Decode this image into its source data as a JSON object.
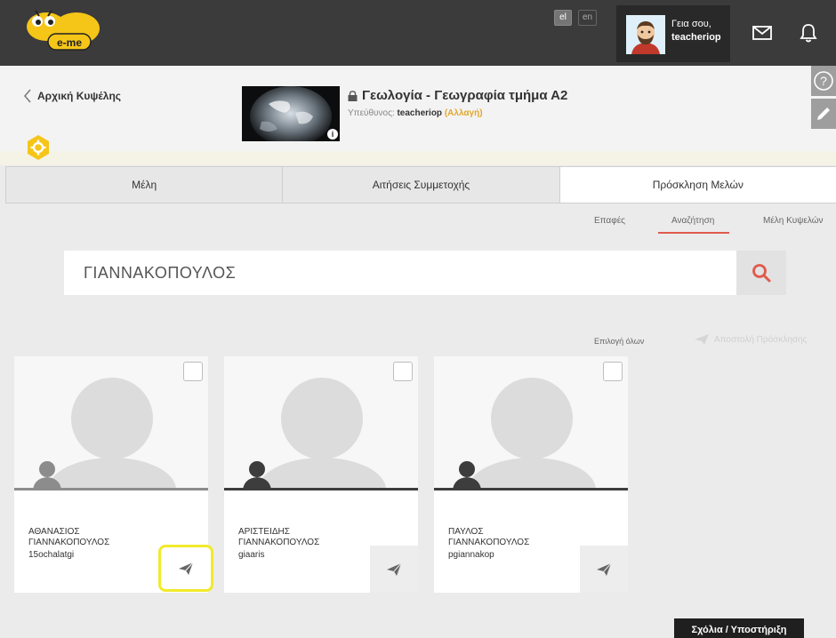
{
  "topbar": {
    "logo_text": "e-me",
    "languages": [
      "el",
      "en"
    ],
    "active_language": "el",
    "greeting_line1": "Γεια σου,",
    "greeting_line2": "teacheriop",
    "icons": [
      "mail-icon",
      "bell-icon"
    ]
  },
  "header": {
    "back_label": "Αρχική Κυψέλης",
    "hive_title": "Γεωλογία - Γεωγραφία τμήμα Α2",
    "owner_label": "Υπεύθυνος:",
    "owner_name": "teacheriop",
    "owner_change": "(Αλλαγή)",
    "info_badge": "i",
    "side_icons": [
      "help-icon",
      "edit-icon"
    ]
  },
  "tabs": [
    {
      "label": "Μέλη",
      "active": false
    },
    {
      "label": "Αιτήσεις Συμμετοχής",
      "active": false
    },
    {
      "label": "Πρόσκληση Μελών",
      "active": true
    }
  ],
  "subtabs": [
    {
      "label": "Επαφές",
      "active": false
    },
    {
      "label": "Αναζήτηση",
      "active": true
    },
    {
      "label": "Μέλη Κυψελών",
      "active": false
    }
  ],
  "search": {
    "value": "ΓΙΑΝΝΑΚΟΠΟΥΛΟΣ"
  },
  "actions": {
    "select_all": "Επιλογή όλων",
    "send_invite": "Αποστολή Πρόσκλησης"
  },
  "cards": [
    {
      "first_name": "ΑΘΑΝΑΣΙΟΣ",
      "last_name": "ΓΙΑΝΝΑΚΟΠΟΥΛΟΣ",
      "username": "15ochalatgi",
      "checked": false,
      "accent": "#8c8c8c",
      "highlighted": true
    },
    {
      "first_name": "ΑΡΙΣΤΕΙΔΗΣ",
      "last_name": "ΓΙΑΝΝΑΚΟΠΟΥΛΟΣ",
      "username": "giaaris",
      "checked": false,
      "accent": "#3d3d3d",
      "highlighted": false
    },
    {
      "first_name": "ΠΑΥΛΟΣ",
      "last_name": "ΓΙΑΝΝΑΚΟΠΟΥΛΟΣ",
      "username": "pgiannakop",
      "checked": false,
      "accent": "#3d3d3d",
      "highlighted": false
    }
  ],
  "footer": {
    "feedback_label": "Σχόλια / Υποστήριξη"
  },
  "colors": {
    "topbar": "#3b3b3b",
    "accent_red": "#e05a4b",
    "accent_yellow": "#f5c518",
    "highlight": "#f1ea2a"
  }
}
